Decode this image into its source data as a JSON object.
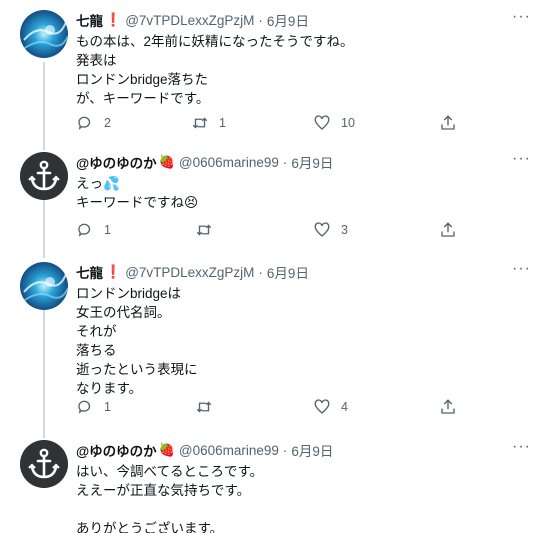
{
  "tweets": [
    {
      "name": "七龍",
      "name_mark": "❗",
      "handle": "@7vTPDLexxZgPzjM",
      "date": "6月9日",
      "text": "もの本は、2年前に妖精になったそうですね。\n発表は\nロンドンbridge落ちた\nが、キーワードです。",
      "reply": "2",
      "retweet": "1",
      "like": "10",
      "more": "···"
    },
    {
      "name": "@ゆのゆのか",
      "name_mark": "🍓",
      "handle": "@0606marine99",
      "date": "6月9日",
      "text": "えっ💦\nキーワードですね😣",
      "reply": "1",
      "retweet": "",
      "like": "3",
      "more": "···"
    },
    {
      "name": "七龍",
      "name_mark": "❗",
      "handle": "@7vTPDLexxZgPzjM",
      "date": "6月9日",
      "text": "ロンドンbridgeは\n女王の代名詞。\nそれが\n落ちる\n逝ったという表現に\nなります。",
      "reply": "1",
      "retweet": "",
      "like": "4",
      "more": "···"
    },
    {
      "name": "@ゆのゆのか",
      "name_mark": "🍓",
      "handle": "@0606marine99",
      "date": "6月9日",
      "text": "はい、今調べてるところです。\nええーが正直な気持ちです。\n\nありがとうございます。",
      "more": "···"
    }
  ],
  "dot": "·",
  "colors": {
    "text": "#0f1419",
    "muted": "#536471",
    "thread_line": "#cfd9de"
  }
}
